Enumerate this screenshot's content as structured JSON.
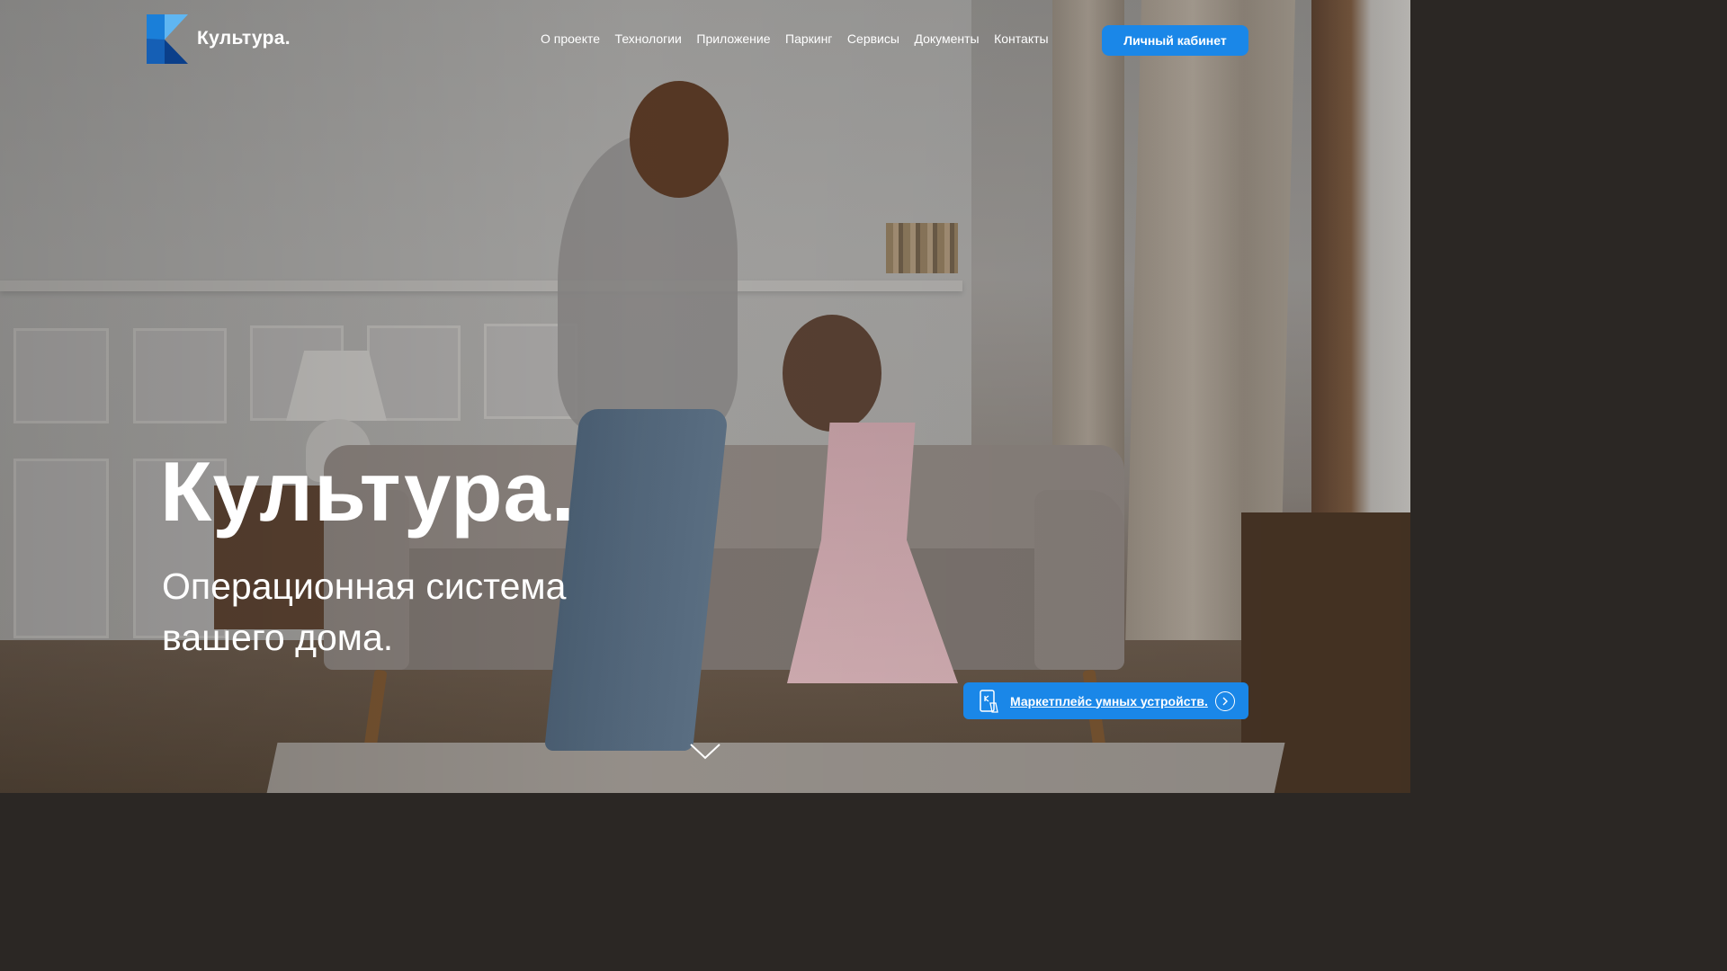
{
  "brand": {
    "name": "Культура.",
    "accent_color": "#1a87e8",
    "logo_colors": [
      "#1d6fc9",
      "#0b3f8a",
      "#5fb6f2"
    ]
  },
  "nav": {
    "items": [
      {
        "label": "О проекте"
      },
      {
        "label": "Технологии"
      },
      {
        "label": "Приложение"
      },
      {
        "label": "Паркинг"
      },
      {
        "label": "Сервисы"
      },
      {
        "label": "Документы"
      },
      {
        "label": "Контакты"
      }
    ],
    "cabinet_label": "Личный кабинет"
  },
  "hero": {
    "title": "Культура.",
    "subtitle_line1": "Операционная система",
    "subtitle_line2": "вашего дома.",
    "background_photo": "mother and daughter dancing in a bright living room",
    "marketplace_label": "Маркетплейс умных устройств.",
    "marketplace_icon": "smartphone-icon",
    "marketplace_arrow_icon": "arrow-right-circle-icon",
    "scroll_icon": "chevron-down-icon"
  }
}
